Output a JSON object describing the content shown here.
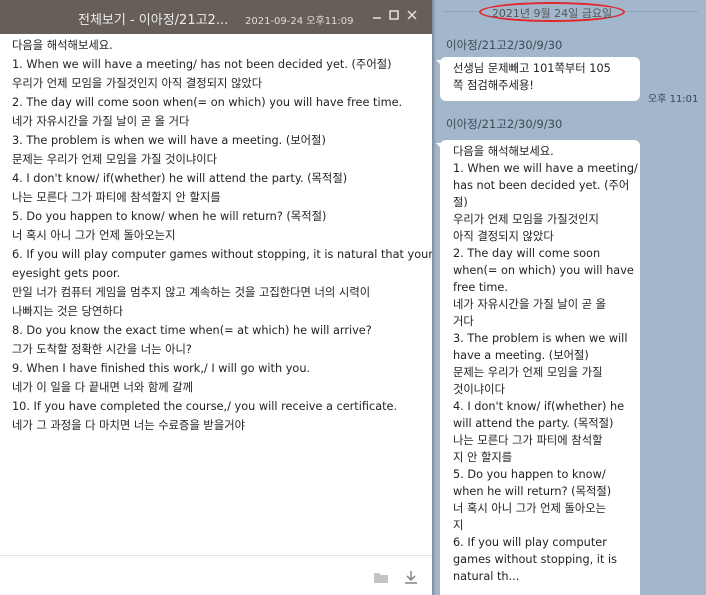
{
  "viewer": {
    "title": "전체보기 - 이아정/21고2...",
    "title_date": "2021-09-24 오후11:09",
    "window_buttons": {
      "minimize_icon": "minimize-icon",
      "maximize_icon": "maximize-icon",
      "close_icon": "close-icon"
    },
    "lines": [
      "다음을 해석해보세요.",
      "1. When we will have a meeting/ has not been decided yet. (주어절)",
      "우리가 언제 모임을 가질것인지 아직 결정되지 않았다",
      "2. The day will come soon when(= on which) you will have free time.",
      "네가 자유시간을 가질 날이 곧 올 거다",
      "3. The problem is when we will have a meeting. (보어절)",
      "문제는 우리가 언제 모임을 가질 것이냐이다",
      "4. I don't know/ if(whether) he will attend the party. (목적절)",
      "나는 모른다 그가 파티에 참석할지 안 할지를",
      "5. Do you happen to know/ when he will return? (목적절)",
      "너 혹시 아니 그가 언제 돌아오는지",
      "6. If you will play computer games without stopping, it is natural that your",
      "eyesight gets poor.",
      "만일 너가 컴퓨터 게임을 멈추지 않고 계속하는 것을 고집한다면 너의 시력이",
      "나빠지는 것은 당연하다",
      "8. Do you know the exact time when(= at which) he will arrive?",
      "그가 도착할 정확한 시간을 너는 아니?",
      "9. When I have finished this work,/ I will go with you.",
      "네가 이 일을 다 끝내면 너와 함께 갈께",
      "10. If you have completed the course,/ you will receive a certificate.",
      "네가 그 과정을 다 마치면 너는 수료증을 받을거야"
    ],
    "footer": {
      "folder_icon": "folder-icon",
      "download_icon": "download-icon"
    }
  },
  "chat": {
    "date_divider": "2021년 9월 24일 금요일",
    "messages": [
      {
        "sender": "이아정/21고2/30/9/30",
        "lines": [
          "선생님 문제빼고 101쪽부터 105",
          "쪽 점검해주세용!"
        ],
        "time": "오후 11:01"
      },
      {
        "sender": "이아정/21고2/30/9/30",
        "lines": [
          "다음을 해석해보세요.",
          "1. When we will have a meeting/",
          " has not been decided yet. (주어",
          "절)",
          "우리가 언제 모임을 가질것인지",
          "아직 결정되지 않았다",
          "2. The day will come soon",
          "when(= on which) you will have",
          "free time.",
          "네가 자유시간을 가질 날이 곧 올",
          "거다",
          "3. The problem is when we will",
          "have a meeting. (보어절)",
          "문제는 우리가 언제 모임을 가질",
          "것이냐이다",
          "4. I don't know/ if(whether) he",
          "will attend the party. (목적절)",
          "나는 모른다 그가 파티에 참석할",
          "지 안 할지를",
          "5. Do you happen to know/",
          "when he will return? (목적절)",
          "너 혹시 아니 그가 언제 돌아오는",
          "지",
          "6. If you will play computer",
          "games without stopping, it is",
          "natural th..."
        ]
      }
    ]
  }
}
